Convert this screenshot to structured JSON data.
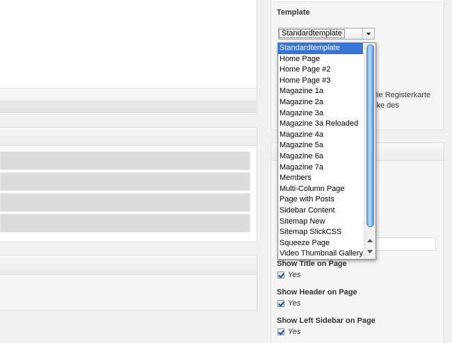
{
  "template": {
    "label": "Template",
    "selected": "Standardtemplate",
    "options": [
      "Standardtemplate",
      "Home Page",
      "Home Page #2",
      "Home Page #3",
      "Magazine 1a",
      "Magazine 2a",
      "Magazine 3a",
      "Magazine 3a Reloaded",
      "Magazine 4a",
      "Magazine 5a",
      "Magazine 6a",
      "Magazine 7a",
      "Members",
      "Multi-Column Page",
      "Page with Posts",
      "Sidebar Content",
      "Sitemap New",
      "Sitemap SlickCSS",
      "Squeeze Page",
      "Video Thumbnail Gallery"
    ]
  },
  "help_text": {
    "line1": "die Registerkarte",
    "line2": "cke des"
  },
  "options": {
    "show_title": {
      "label": "Show Title on Page",
      "value": "Yes"
    },
    "show_header": {
      "label": "Show Header on Page",
      "value": "Yes"
    },
    "show_left_sidebar": {
      "label": "Show Left Sidebar on Page",
      "value": "Yes"
    }
  },
  "colors": {
    "selection": "#3875d7",
    "background": "#f1f1f1",
    "checkbox_mark": "#1d4f91"
  },
  "icons": {
    "select_arrow": "chevron-down-icon",
    "checkbox": "checkbox-checked-icon",
    "scroll_up": "arrow-up-icon",
    "scroll_down": "arrow-down-icon"
  }
}
